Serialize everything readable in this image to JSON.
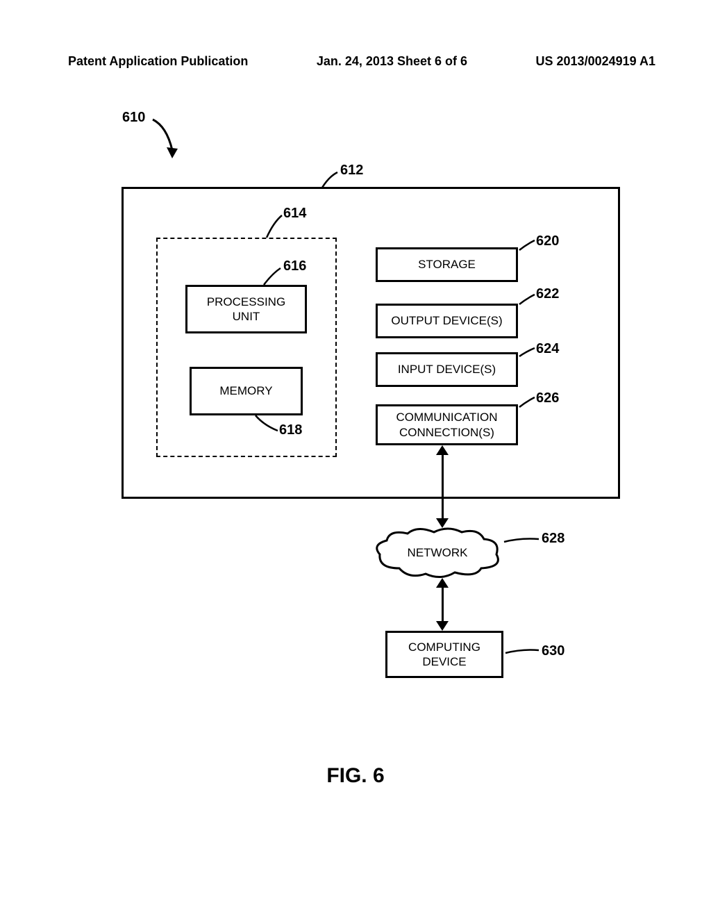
{
  "header": {
    "left": "Patent Application Publication",
    "center": "Jan. 24, 2013  Sheet 6 of 6",
    "right": "US 2013/0024919 A1"
  },
  "labels": {
    "ref610": "610",
    "ref612": "612",
    "ref614": "614",
    "ref616": "616",
    "ref618": "618",
    "ref620": "620",
    "ref622": "622",
    "ref624": "624",
    "ref626": "626",
    "ref628": "628",
    "ref630": "630"
  },
  "boxes": {
    "processing_unit": "PROCESSING\nUNIT",
    "memory": "MEMORY",
    "storage": "STORAGE",
    "output_devices": "OUTPUT DEVICE(S)",
    "input_devices": "INPUT DEVICE(S)",
    "communication": "COMMUNICATION\nCONNECTION(S)",
    "network": "NETWORK",
    "computing_device": "COMPUTING\nDEVICE"
  },
  "figure_caption": "FIG. 6"
}
